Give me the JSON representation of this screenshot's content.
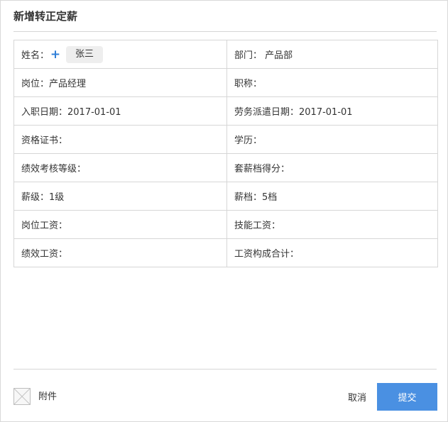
{
  "dialog": {
    "title": "新增转正定薪"
  },
  "form": {
    "name_label": "姓名：",
    "name_value": "张三",
    "rows": [
      {
        "left": "岗位：产品经理",
        "right": "职称："
      },
      {
        "left": "入职日期：2017-01-01",
        "right": "劳务派遣日期：2017-01-01"
      },
      {
        "left": "资格证书：",
        "right": "学历："
      },
      {
        "left": "绩效考核等级：",
        "right": "套薪档得分："
      },
      {
        "left": "薪级：1级",
        "right": "薪档：5档"
      },
      {
        "left": "岗位工资：",
        "right": "技能工资："
      },
      {
        "left": "绩效工资：",
        "right": "工资构成合计："
      }
    ],
    "dept_text": "部门：  产品部"
  },
  "footer": {
    "attach_label": "附件",
    "cancel_label": "取消",
    "submit_label": "提交"
  },
  "icons": {
    "plus": "plus-icon",
    "attachment": "attachment-icon"
  },
  "colors": {
    "accent": "#4a90e2",
    "plus": "#2f7fd8",
    "border": "#d6d6d6",
    "tag_bg": "#eeeeee"
  }
}
